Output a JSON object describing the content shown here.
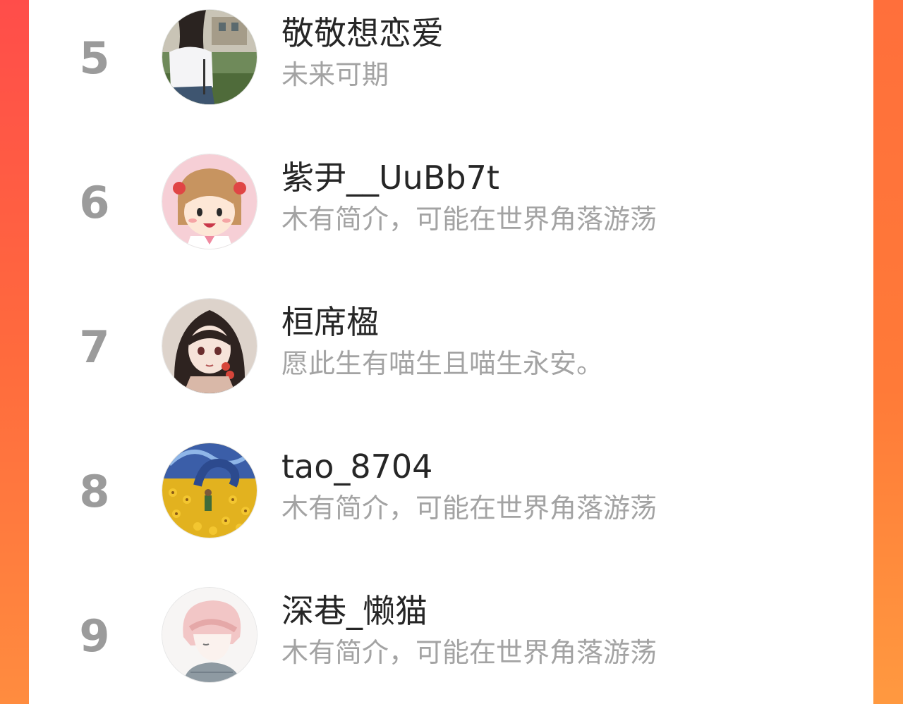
{
  "ranking": {
    "items": [
      {
        "rank": "5",
        "name": "敬敬想恋爱",
        "bio": "未来可期",
        "avatar_icon": "girl-photo-avatar"
      },
      {
        "rank": "6",
        "name": "紫尹__UuBb7t",
        "bio": "木有简介，可能在世界角落游荡",
        "avatar_icon": "anime-girl-avatar"
      },
      {
        "rank": "7",
        "name": "桓席楹",
        "bio": "愿此生有喵生且喵生永安。",
        "avatar_icon": "anime-longhair-girl-avatar"
      },
      {
        "rank": "8",
        "name": "tao_8704",
        "bio": "木有简介，可能在世界角落游荡",
        "avatar_icon": "sunflower-field-avatar"
      },
      {
        "rank": "9",
        "name": "深巷_懒猫",
        "bio": "木有简介，可能在世界角落游荡",
        "avatar_icon": "anime-boy-avatar"
      }
    ]
  },
  "colors": {
    "background_gradient_top": "#ff4d4a",
    "background_gradient_bottom": "#ff8c3f",
    "card": "#ffffff",
    "rank_text": "#9b9b9b",
    "name_text": "#262626",
    "bio_text": "#a3a3a3"
  }
}
